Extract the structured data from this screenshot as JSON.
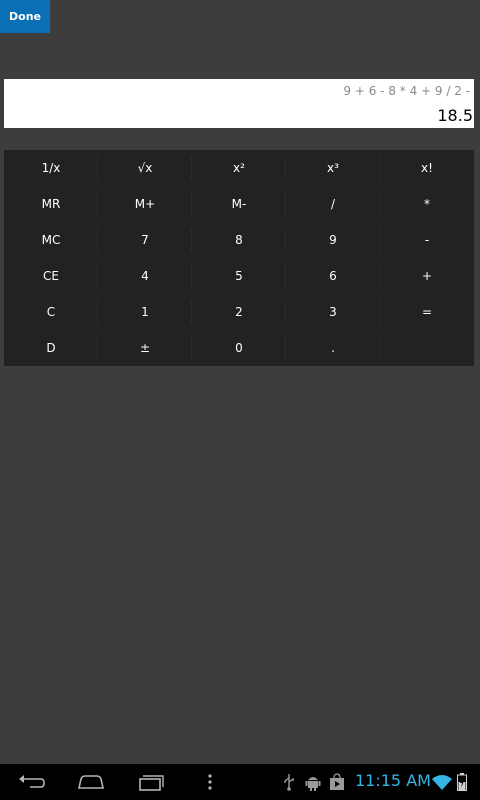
{
  "header": {
    "done_label": "Done"
  },
  "display": {
    "expression": "9 + 6 - 8 * 4 + 9 / 2 -",
    "result": "18.5"
  },
  "keypad": {
    "rows": [
      [
        "1/x",
        "√x",
        "x²",
        "x³",
        "x!"
      ],
      [
        "MR",
        "M+",
        "M-",
        "/",
        "*"
      ],
      [
        "MC",
        "7",
        "8",
        "9",
        "-"
      ],
      [
        "CE",
        "4",
        "5",
        "6",
        "+"
      ],
      [
        "C",
        "1",
        "2",
        "3",
        "="
      ],
      [
        "D",
        "±",
        "0",
        ".",
        ""
      ]
    ]
  },
  "status_bar": {
    "time": "11:15 AM",
    "icons": [
      "usb-icon",
      "android-debug-icon",
      "play-store-icon",
      "wifi-icon",
      "battery-icon"
    ]
  },
  "navigation": {
    "buttons": [
      "back",
      "home",
      "recent-apps",
      "menu"
    ]
  },
  "colors": {
    "background": "#3d3d3d",
    "done_button": "#0b6fb5",
    "keypad": "#222222",
    "display": "#ffffff",
    "expression_text": "#8a8a8a",
    "clock": "#33b5e5",
    "nav_bar": "#000000"
  }
}
